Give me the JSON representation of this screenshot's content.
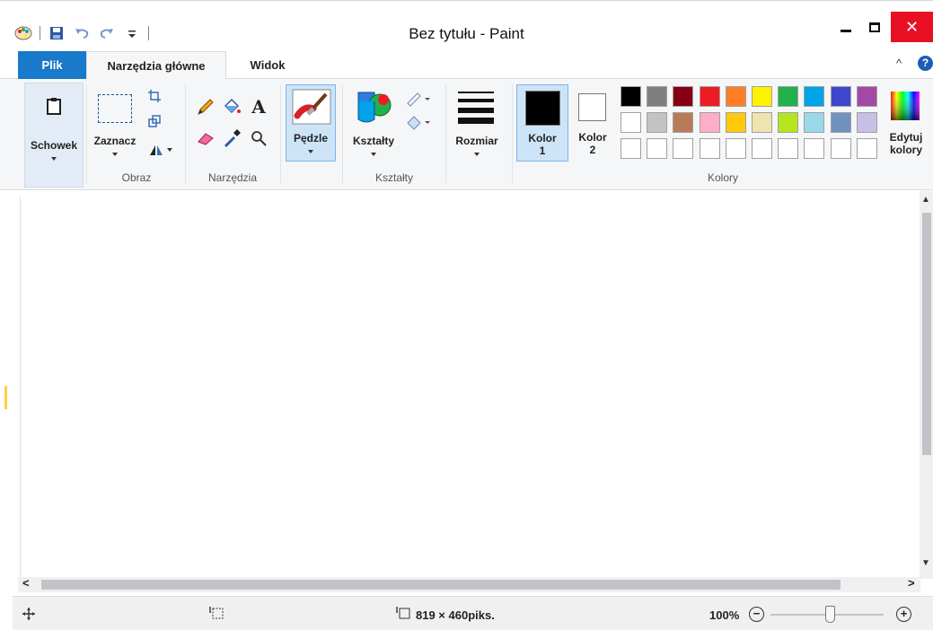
{
  "window": {
    "title": "Bez tytułu - Paint",
    "close_glyph": "✕"
  },
  "quick_access": {
    "icons": [
      "paint-app-icon",
      "save-icon",
      "undo-icon",
      "redo-icon",
      "customize-qat-icon"
    ]
  },
  "tabs": [
    {
      "label": "Plik"
    },
    {
      "label": "Narzędzia główne"
    },
    {
      "label": "Widok"
    }
  ],
  "ribbon": {
    "collapse_glyph": "^",
    "help_glyph": "?",
    "clipboard": {
      "label": "Schowek"
    },
    "image_group": {
      "label": "Obraz",
      "select_label": "Zaznacz"
    },
    "tools_group": {
      "label": "Narzędzia"
    },
    "brushes": {
      "label": "Pędzle"
    },
    "shapes_group": {
      "label": "Kształty",
      "shapes_label": "Kształty"
    },
    "size": {
      "label": "Rozmiar"
    },
    "color1": {
      "line1": "Kolor",
      "line2": "1",
      "color": "#000000"
    },
    "color2": {
      "line1": "Kolor",
      "line2": "2",
      "color": "#ffffff"
    },
    "colors_group": {
      "label": "Kolory"
    },
    "edit_colors": {
      "line1": "Edytuj",
      "line2": "kolory"
    },
    "text_tool_glyph": "A"
  },
  "palette": {
    "row1": [
      "#000000",
      "#7f7f7f",
      "#880015",
      "#ed1c24",
      "#ff7f27",
      "#fff200",
      "#22b14c",
      "#00a2e8",
      "#3f48cc",
      "#a349a4"
    ],
    "row2": [
      "#ffffff",
      "#c3c3c3",
      "#b97a57",
      "#ffaec9",
      "#ffc90e",
      "#efe4b0",
      "#b5e61d",
      "#99d9ea",
      "#7092be",
      "#c8bfe7"
    ],
    "row3": [
      "#ffffff",
      "#ffffff",
      "#ffffff",
      "#ffffff",
      "#ffffff",
      "#ffffff",
      "#ffffff",
      "#ffffff",
      "#ffffff",
      "#ffffff"
    ]
  },
  "statusbar": {
    "cursor_icon": "move-cursor-icon",
    "selection_icon": "selection-size-icon",
    "canvas_size": "819 × 460piks.",
    "zoom": "100%",
    "zoom_out_glyph": "−",
    "zoom_in_glyph": "+"
  },
  "scrollbars": {
    "left_glyph": "<",
    "right_glyph": ">",
    "up_glyph": "▲",
    "down_glyph": "▼"
  }
}
